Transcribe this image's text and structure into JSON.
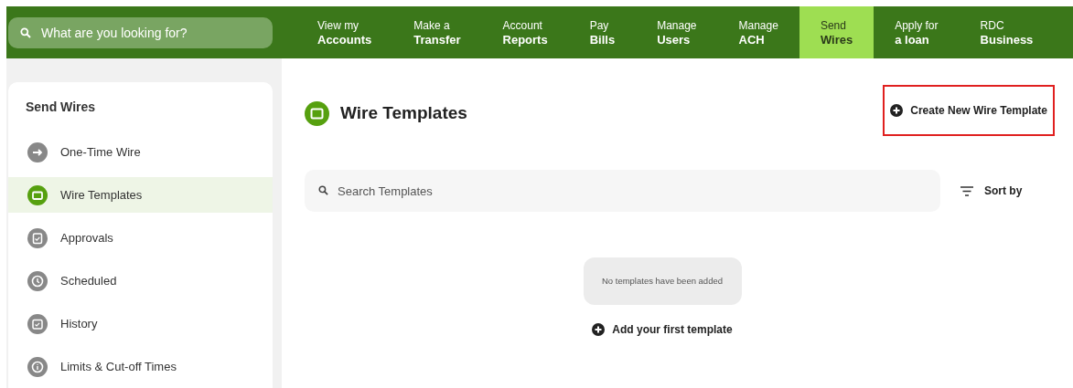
{
  "search": {
    "placeholder": "What are you looking for?"
  },
  "nav": [
    {
      "line1": "View my",
      "line2": "Accounts",
      "selected": false
    },
    {
      "line1": "Make a",
      "line2": "Transfer",
      "selected": false
    },
    {
      "line1": "Account",
      "line2": "Reports",
      "selected": false
    },
    {
      "line1": "Pay",
      "line2": "Bills",
      "selected": false
    },
    {
      "line1": "Manage",
      "line2": "Users",
      "selected": false
    },
    {
      "line1": "Manage",
      "line2": "ACH",
      "selected": false
    },
    {
      "line1": "Send",
      "line2": "Wires",
      "selected": true
    },
    {
      "line1": "Apply for",
      "line2": "a loan",
      "selected": false
    },
    {
      "line1": "RDC",
      "line2": "Business",
      "selected": false
    }
  ],
  "sidebar": {
    "title": "Send Wires",
    "items": [
      {
        "label": "One-Time Wire",
        "kind": "arrow",
        "selected": false
      },
      {
        "label": "Wire Templates",
        "kind": "folder",
        "selected": true
      },
      {
        "label": "Approvals",
        "kind": "clipboard",
        "selected": false
      },
      {
        "label": "Scheduled",
        "kind": "clock",
        "selected": false
      },
      {
        "label": "History",
        "kind": "calendar",
        "selected": false
      },
      {
        "label": "Limits & Cut-off Times",
        "kind": "info",
        "selected": false
      }
    ]
  },
  "main": {
    "title": "Wire Templates",
    "create_button": {
      "label": "Create New Wire Template",
      "highlighted": true
    },
    "search": {
      "placeholder": "Search Templates"
    },
    "sort_button": "Sort by",
    "empty_message": "No templates have been added",
    "add_link": "Add your first template"
  }
}
